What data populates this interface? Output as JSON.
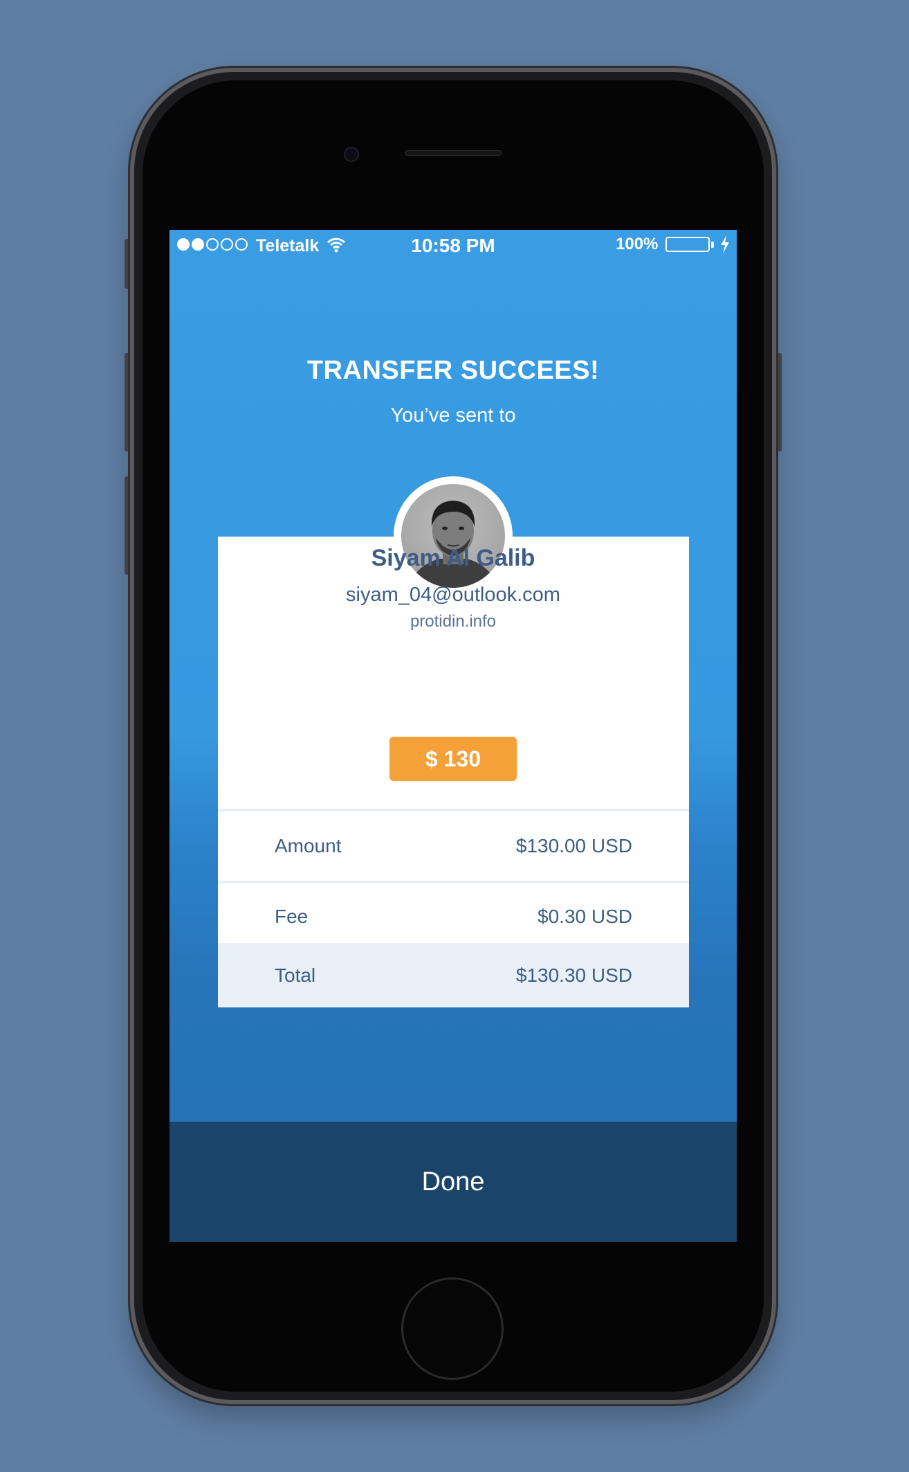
{
  "status_bar": {
    "carrier": "Teletalk",
    "time": "10:58 PM",
    "battery": "100%"
  },
  "header": {
    "title": "TRANSFER SUCCEES!",
    "subtitle": "You’ve sent to"
  },
  "recipient": {
    "name": "Siyam Al Galib",
    "email": "siyam_04@outlook.com",
    "website": "protidin.info",
    "amount_badge": "$ 130"
  },
  "summary": [
    {
      "label": "Amount",
      "value": "$130.00 USD"
    },
    {
      "label": "Fee",
      "value": "$0.30 USD"
    },
    {
      "label": "Total",
      "value": "$130.30 USD"
    }
  ],
  "actions": {
    "done_label": "Done"
  },
  "colors": {
    "screen_top": "#3a9de3",
    "screen_bottom": "#2572b5",
    "badge": "#f5a039",
    "done_bar": "#1a4469",
    "text_primary": "#3d5d86",
    "total_row_bg": "#e9f0f8"
  }
}
